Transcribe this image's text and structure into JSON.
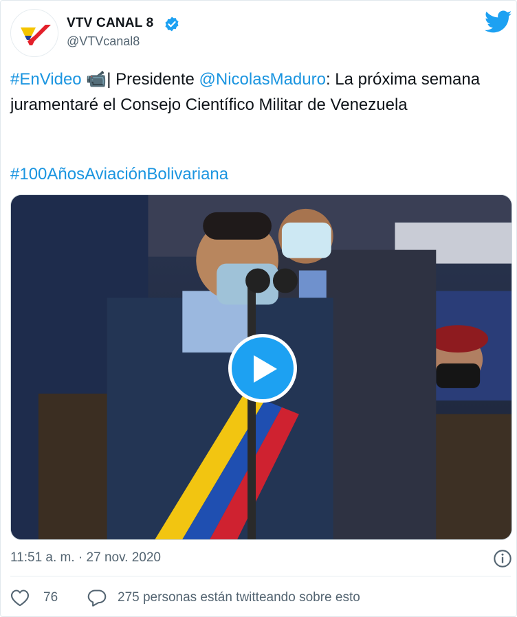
{
  "account": {
    "display_name": "VTV CANAL 8",
    "handle": "@VTVcanal8",
    "verified": true,
    "avatar_icon": "vtv-logo"
  },
  "tweet": {
    "hashtag1": "#EnVideo",
    "emoji": "📹",
    "text_part1": "| Presidente ",
    "mention": "@NicolasMaduro",
    "text_part2": ": La próxima semana juramentaré el Consejo Científico Militar de Venezuela",
    "hashtag2": "#100AñosAviaciónBolivariana"
  },
  "media": {
    "type": "video",
    "play_icon": "play-icon"
  },
  "footer": {
    "timestamp": "11:51 a. m. · 27 nov. 2020",
    "likes": "76",
    "talking": "275 personas están twitteando sobre esto"
  },
  "colors": {
    "link": "#1b95e0",
    "twitter_blue": "#1da1f2",
    "muted": "#536471"
  }
}
